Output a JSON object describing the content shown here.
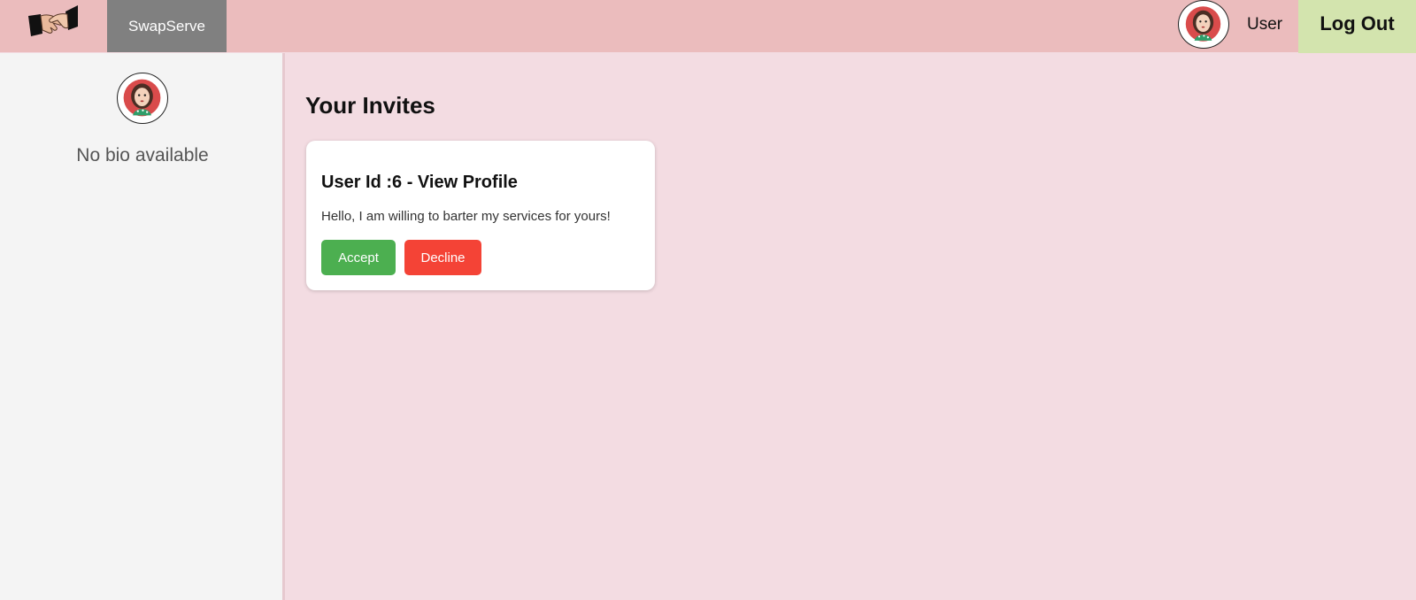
{
  "app": {
    "brand": "SwapServe"
  },
  "header": {
    "user_label": "User",
    "logout_label": "Log Out"
  },
  "sidebar": {
    "bio": "No bio available"
  },
  "main": {
    "title": "Your Invites",
    "invites": [
      {
        "title": "User Id :6 - View Profile",
        "message": "Hello, I am willing to barter my services for yours!",
        "accept_label": "Accept",
        "decline_label": "Decline"
      }
    ]
  },
  "colors": {
    "header_bg": "#ebbcbd",
    "brand_tab_bg": "#808080",
    "logout_bg": "#d3e4ae",
    "page_bg": "#f3dce2",
    "sidebar_bg": "#f4f4f4",
    "accept": "#4caf50",
    "decline": "#f44336"
  },
  "icons": {
    "logo": "handshake-icon",
    "avatar": "user-avatar-icon"
  }
}
